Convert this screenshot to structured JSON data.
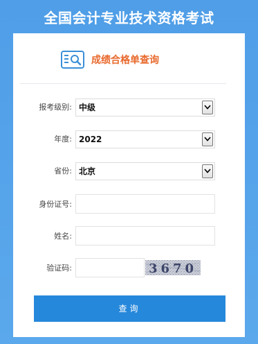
{
  "page": {
    "title": "全国会计专业技术资格考试",
    "subtitle": "成绩合格单查询"
  },
  "form": {
    "level_label": "报考级别:",
    "level_value": "中级",
    "year_label": "年度:",
    "year_value": "2022",
    "province_label": "省份:",
    "province_value": "北京",
    "id_label": "身份证号:",
    "name_label": "姓名:",
    "captcha_label": "验证码:",
    "captcha_image_text": "3670"
  },
  "actions": {
    "submit_label": "查询"
  },
  "colors": {
    "background": "#4f9ee7",
    "accent_orange": "#e8692d",
    "button_blue": "#2688db"
  },
  "icons": {
    "header_icon": "search-document-icon",
    "dropdown_icon": "chevron-down-icon"
  }
}
